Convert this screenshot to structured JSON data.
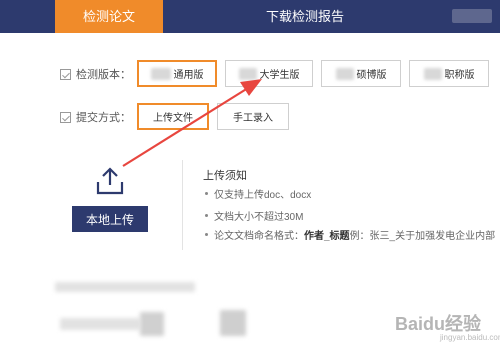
{
  "header": {
    "tabs": [
      {
        "label": "检测论文",
        "active": true
      },
      {
        "label": "下载检测报告",
        "active": false
      }
    ],
    "accent_color": "#f08b2a",
    "bar_color": "#2d3a6e"
  },
  "version_row": {
    "label": "检测版本：",
    "options": [
      {
        "label": "通用版",
        "selected": true
      },
      {
        "label": "大学生版",
        "selected": false
      },
      {
        "label": "硕博版",
        "selected": false
      },
      {
        "label": "职称版",
        "selected": false
      }
    ]
  },
  "submit_row": {
    "label": "提交方式：",
    "options": [
      {
        "label": "上传文件",
        "selected": true
      },
      {
        "label": "手工录入",
        "selected": false
      }
    ]
  },
  "upload": {
    "icon": "upload-icon",
    "button_label": "本地上传"
  },
  "notice": {
    "title": "上传须知",
    "items": [
      "仅支持上传doc、docx",
      "文档大小不超过30M"
    ],
    "naming_prefix": "论文文档命名格式：",
    "naming_format": "作者_标题",
    "naming_example": " 例：张三_关于加强发电企业内部"
  },
  "watermark": {
    "text": "Baidu经验",
    "sub": "jingyan.baidu.com"
  }
}
